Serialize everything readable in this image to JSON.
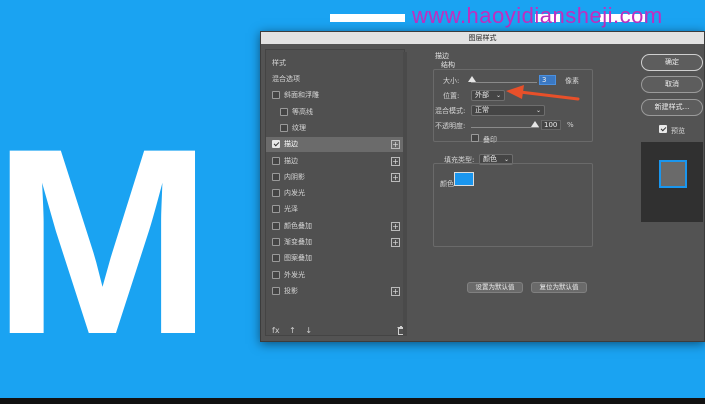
{
  "canvas": {
    "letter": "M"
  },
  "watermark": "www.haoyidiansheji.com",
  "dialog": {
    "title": "图层样式",
    "left": {
      "header": "样式",
      "items": [
        {
          "label": "混合选项",
          "checkbox": false,
          "checked": false,
          "plus": false,
          "indent": false
        },
        {
          "label": "斜面和浮雕",
          "checkbox": true,
          "checked": false,
          "plus": false,
          "indent": false
        },
        {
          "label": "等高线",
          "checkbox": true,
          "checked": false,
          "plus": false,
          "indent": true
        },
        {
          "label": "纹理",
          "checkbox": true,
          "checked": false,
          "plus": false,
          "indent": true
        },
        {
          "label": "描边",
          "checkbox": true,
          "checked": true,
          "plus": true,
          "indent": false,
          "active": true
        },
        {
          "label": "描边",
          "checkbox": true,
          "checked": false,
          "plus": true,
          "indent": false
        },
        {
          "label": "内阴影",
          "checkbox": true,
          "checked": false,
          "plus": true,
          "indent": false
        },
        {
          "label": "内发光",
          "checkbox": true,
          "checked": false,
          "plus": false,
          "indent": false
        },
        {
          "label": "光泽",
          "checkbox": true,
          "checked": false,
          "plus": false,
          "indent": false
        },
        {
          "label": "颜色叠加",
          "checkbox": true,
          "checked": false,
          "plus": true,
          "indent": false
        },
        {
          "label": "渐变叠加",
          "checkbox": true,
          "checked": false,
          "plus": true,
          "indent": false
        },
        {
          "label": "图案叠加",
          "checkbox": true,
          "checked": false,
          "plus": false,
          "indent": false
        },
        {
          "label": "外发光",
          "checkbox": true,
          "checked": false,
          "plus": false,
          "indent": false
        },
        {
          "label": "投影",
          "checkbox": true,
          "checked": false,
          "plus": true,
          "indent": false
        }
      ],
      "footer_icons": [
        "fx",
        "↑",
        "↓"
      ]
    },
    "stroke": {
      "section_title": "描边",
      "structure_title": "结构",
      "size_label": "大小:",
      "size_value": "3",
      "size_unit": "像素",
      "position_label": "位置:",
      "position_value": "外部",
      "blend_label": "混合模式:",
      "blend_value": "正常",
      "opacity_label": "不透明度:",
      "opacity_value": "100",
      "opacity_unit": "%",
      "overprint_label": "叠印",
      "fill_type_label": "填充类型:",
      "fill_type_value": "颜色",
      "color_label": "颜色:",
      "color_hex": "#1a96ee",
      "set_default_button": "设置为默认值",
      "reset_default_button": "复位为默认值"
    },
    "right": {
      "ok_button": "确定",
      "cancel_button": "取消",
      "new_style_button": "新建样式...",
      "preview_label": "预览",
      "preview_checked": true
    }
  },
  "colors": {
    "canvas_bg": "#1aa3f2",
    "annotation_arrow": "#e8502a"
  }
}
